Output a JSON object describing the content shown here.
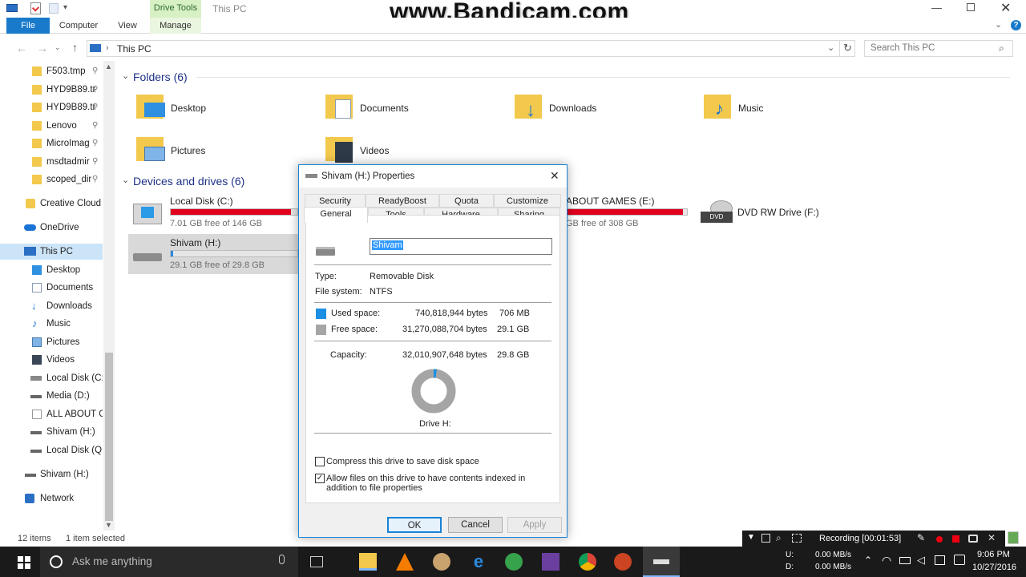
{
  "window": {
    "title": "This PC",
    "watermark": "www.Bandicam.com"
  },
  "ribbon": {
    "tabs": [
      "File",
      "Computer",
      "View"
    ],
    "contextual_group": "Drive Tools",
    "contextual_tab": "Manage"
  },
  "address": {
    "path": "This PC",
    "search_placeholder": "Search This PC"
  },
  "nav": {
    "quick_access": [
      "F503.tmp",
      "HYD9B89.tr",
      "HYD9B89.tr",
      "Lenovo",
      "MicroImag",
      "msdtadmir",
      "scoped_dir"
    ],
    "creative_cloud": "Creative Cloud I",
    "onedrive": "OneDrive",
    "this_pc": "This PC",
    "this_pc_children": [
      "Desktop",
      "Documents",
      "Downloads",
      "Music",
      "Pictures",
      "Videos",
      "Local Disk (C:)",
      "Media (D:)",
      "ALL ABOUT GA",
      "Shivam (H:)",
      "Local Disk (Q:)"
    ],
    "shivam_root": "Shivam (H:)",
    "network": "Network"
  },
  "content": {
    "folders_header": "Folders (6)",
    "folders": [
      "Desktop",
      "Documents",
      "Downloads",
      "Music",
      "Pictures",
      "Videos"
    ],
    "drives_header": "Devices and drives (6)",
    "drives": [
      {
        "name": "Local Disk (C:)",
        "free": "7.01 GB free of 146 GB",
        "used_fraction": 0.95
      },
      {
        "name": "Shivam (H:)",
        "free": "29.1 GB free of 29.8 GB",
        "used_fraction": 0.02
      },
      {
        "name": "ABOUT GAMES (E:)",
        "free": "GB free of 308 GB",
        "used_fraction": 0.97
      },
      {
        "name": "DVD RW Drive (F:)"
      }
    ]
  },
  "dialog": {
    "title": "Shivam (H:) Properties",
    "tabs_row1": [
      "Security",
      "ReadyBoost",
      "Quota",
      "Customize"
    ],
    "tabs_row2": [
      "General",
      "Tools",
      "Hardware",
      "Sharing"
    ],
    "label_value": "Shivam",
    "type_label": "Type:",
    "type_value": "Removable Disk",
    "fs_label": "File system:",
    "fs_value": "NTFS",
    "used_label": "Used space:",
    "used_bytes": "740,818,944 bytes",
    "used_size": "706 MB",
    "free_label": "Free space:",
    "free_bytes": "31,270,088,704 bytes",
    "free_size": "29.1 GB",
    "capacity_label": "Capacity:",
    "capacity_bytes": "32,010,907,648 bytes",
    "capacity_size": "29.8 GB",
    "drive_caption": "Drive H:",
    "used_fraction": 0.023,
    "compress_label": "Compress this drive to save disk space",
    "index_label": "Allow files on this drive to have contents indexed in addition to file properties",
    "compress_checked": false,
    "index_checked": true,
    "ok": "OK",
    "cancel": "Cancel",
    "apply": "Apply",
    "colors": {
      "used": "#1a8fe3",
      "free": "#a5a5a5"
    }
  },
  "status": {
    "items": "12 items",
    "selected": "1 item selected"
  },
  "recording": {
    "text": "Recording [00:01:53]"
  },
  "taskbar": {
    "search_placeholder": "Ask me anything",
    "net_up_label": "U:",
    "net_down_label": "D:",
    "net_up": "0.00 MB/s",
    "net_down": "0.00 MB/s",
    "time": "9:06 PM",
    "date": "10/27/2016"
  }
}
